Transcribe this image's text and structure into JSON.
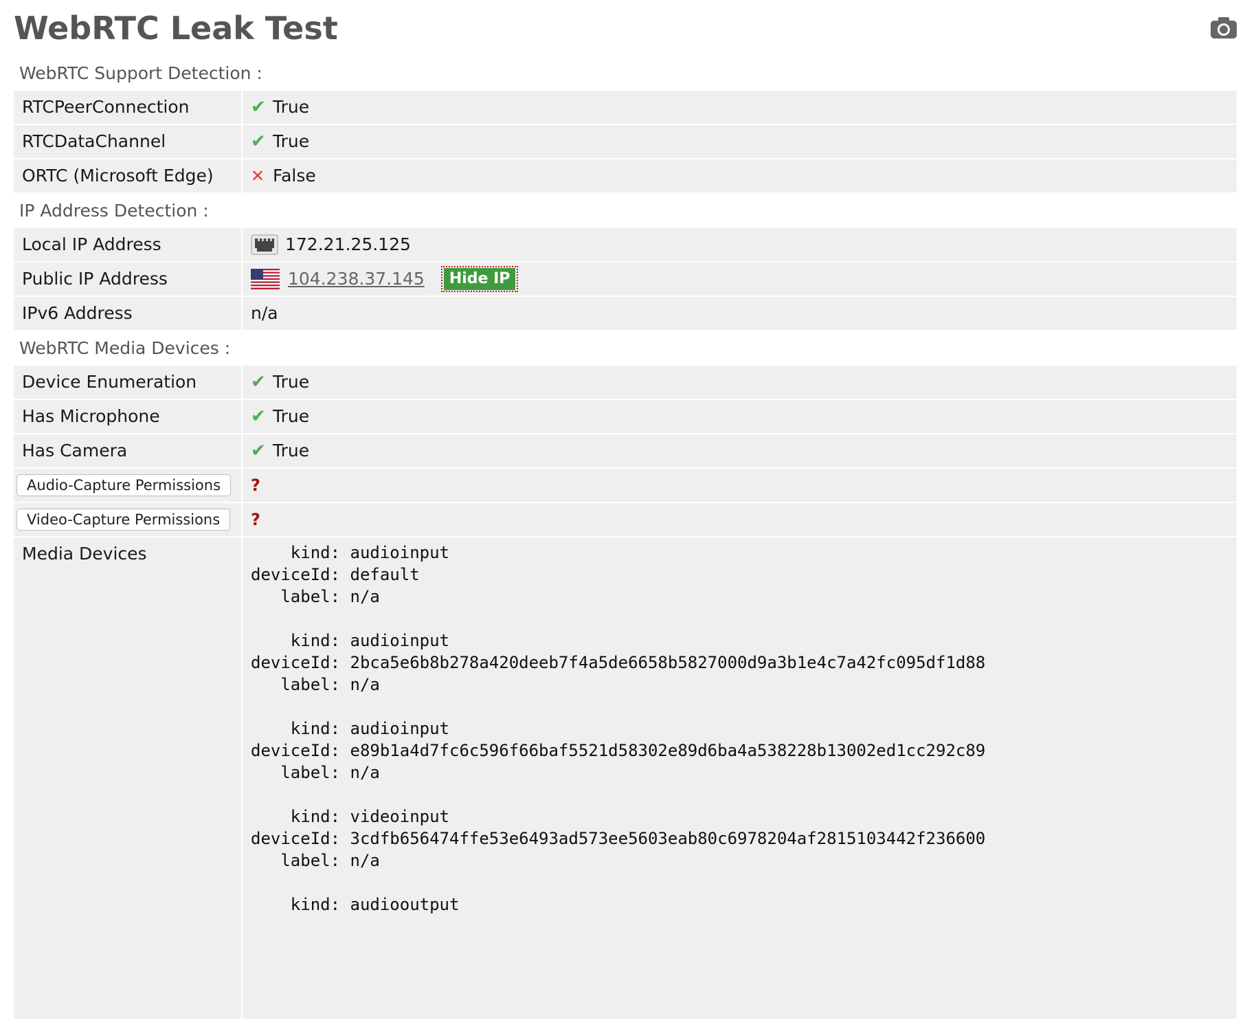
{
  "header": {
    "title": "WebRTC Leak Test",
    "camera_icon": "camera-icon"
  },
  "support": {
    "heading": "WebRTC Support Detection :",
    "rows": [
      {
        "label": "RTCPeerConnection",
        "value": "True",
        "status": "ok"
      },
      {
        "label": "RTCDataChannel",
        "value": "True",
        "status": "ok"
      },
      {
        "label": "ORTC (Microsoft Edge)",
        "value": "False",
        "status": "bad"
      }
    ]
  },
  "ip": {
    "heading": "IP Address Detection :",
    "local": {
      "label": "Local IP Address",
      "value": "172.21.25.125",
      "icon": "network-card-icon"
    },
    "public": {
      "label": "Public IP Address",
      "value": "104.238.37.145",
      "icon": "us-flag-icon",
      "hide_label": "Hide IP"
    },
    "ipv6": {
      "label": "IPv6 Address",
      "value": "n/a"
    }
  },
  "media": {
    "heading": "WebRTC Media Devices :",
    "rows": [
      {
        "label": "Device Enumeration",
        "value": "True",
        "status": "ok"
      },
      {
        "label": "Has Microphone",
        "value": "True",
        "status": "ok"
      },
      {
        "label": "Has Camera",
        "value": "True",
        "status": "ok"
      }
    ],
    "audio_perm": {
      "label": "Audio-Capture Permissions",
      "value": "?"
    },
    "video_perm": {
      "label": "Video-Capture Permissions",
      "value": "?"
    },
    "devices_label": "Media Devices",
    "devices": [
      {
        "kind": "audioinput",
        "deviceId": "default",
        "label": "n/a"
      },
      {
        "kind": "audioinput",
        "deviceId": "2bca5e6b8b278a420deeb7f4a5de6658b5827000d9a3b1e4c7a42fc095df1d88",
        "label": "n/a"
      },
      {
        "kind": "audioinput",
        "deviceId": "e89b1a4d7fc6c596f66baf5521d58302e89d6ba4a538228b13002ed1cc292c89",
        "label": "n/a"
      },
      {
        "kind": "videoinput",
        "deviceId": "3cdfb656474ffe53e6493ad573ee5603eab80c6978204af2815103442f236600",
        "label": "n/a"
      },
      {
        "kind": "audiooutput"
      }
    ]
  },
  "glyphs": {
    "ok": "✔",
    "bad": "✕"
  },
  "colors": {
    "ok": "#4caf50",
    "bad": "#e53935",
    "hide_button": "#3f9b3f"
  }
}
